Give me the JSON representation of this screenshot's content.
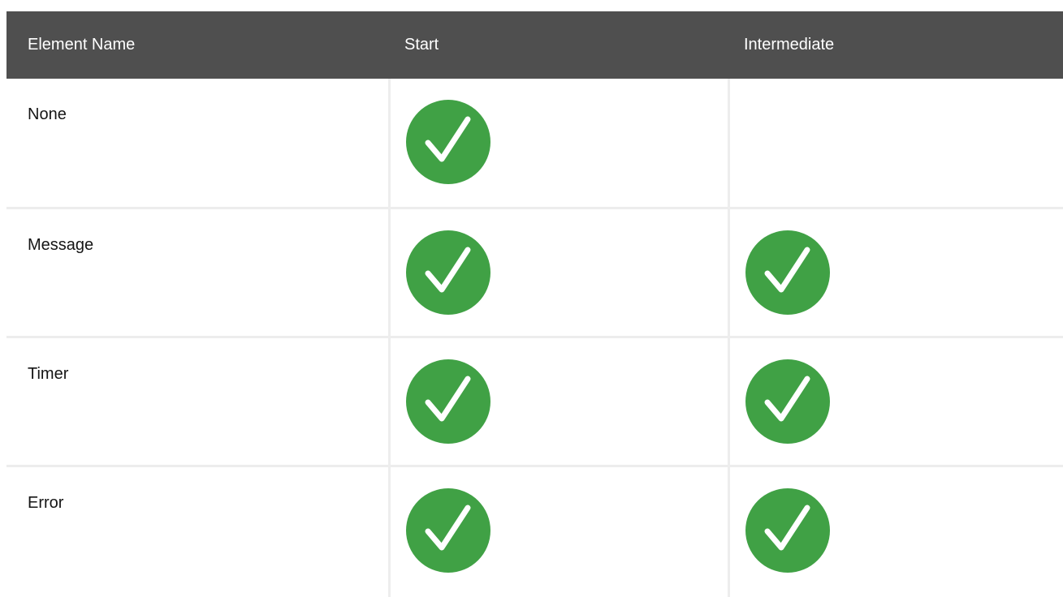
{
  "table": {
    "headers": [
      "Element Name",
      "Start",
      "Intermediate"
    ],
    "rows": [
      {
        "name": "None",
        "start": true,
        "intermediate": false
      },
      {
        "name": "Message",
        "start": true,
        "intermediate": true
      },
      {
        "name": "Timer",
        "start": true,
        "intermediate": true
      },
      {
        "name": "Error",
        "start": true,
        "intermediate": true
      }
    ]
  },
  "colors": {
    "header_bg": "#4f4f4f",
    "check_green": "#40a145"
  },
  "icons": {
    "check": "check-circle-icon"
  }
}
